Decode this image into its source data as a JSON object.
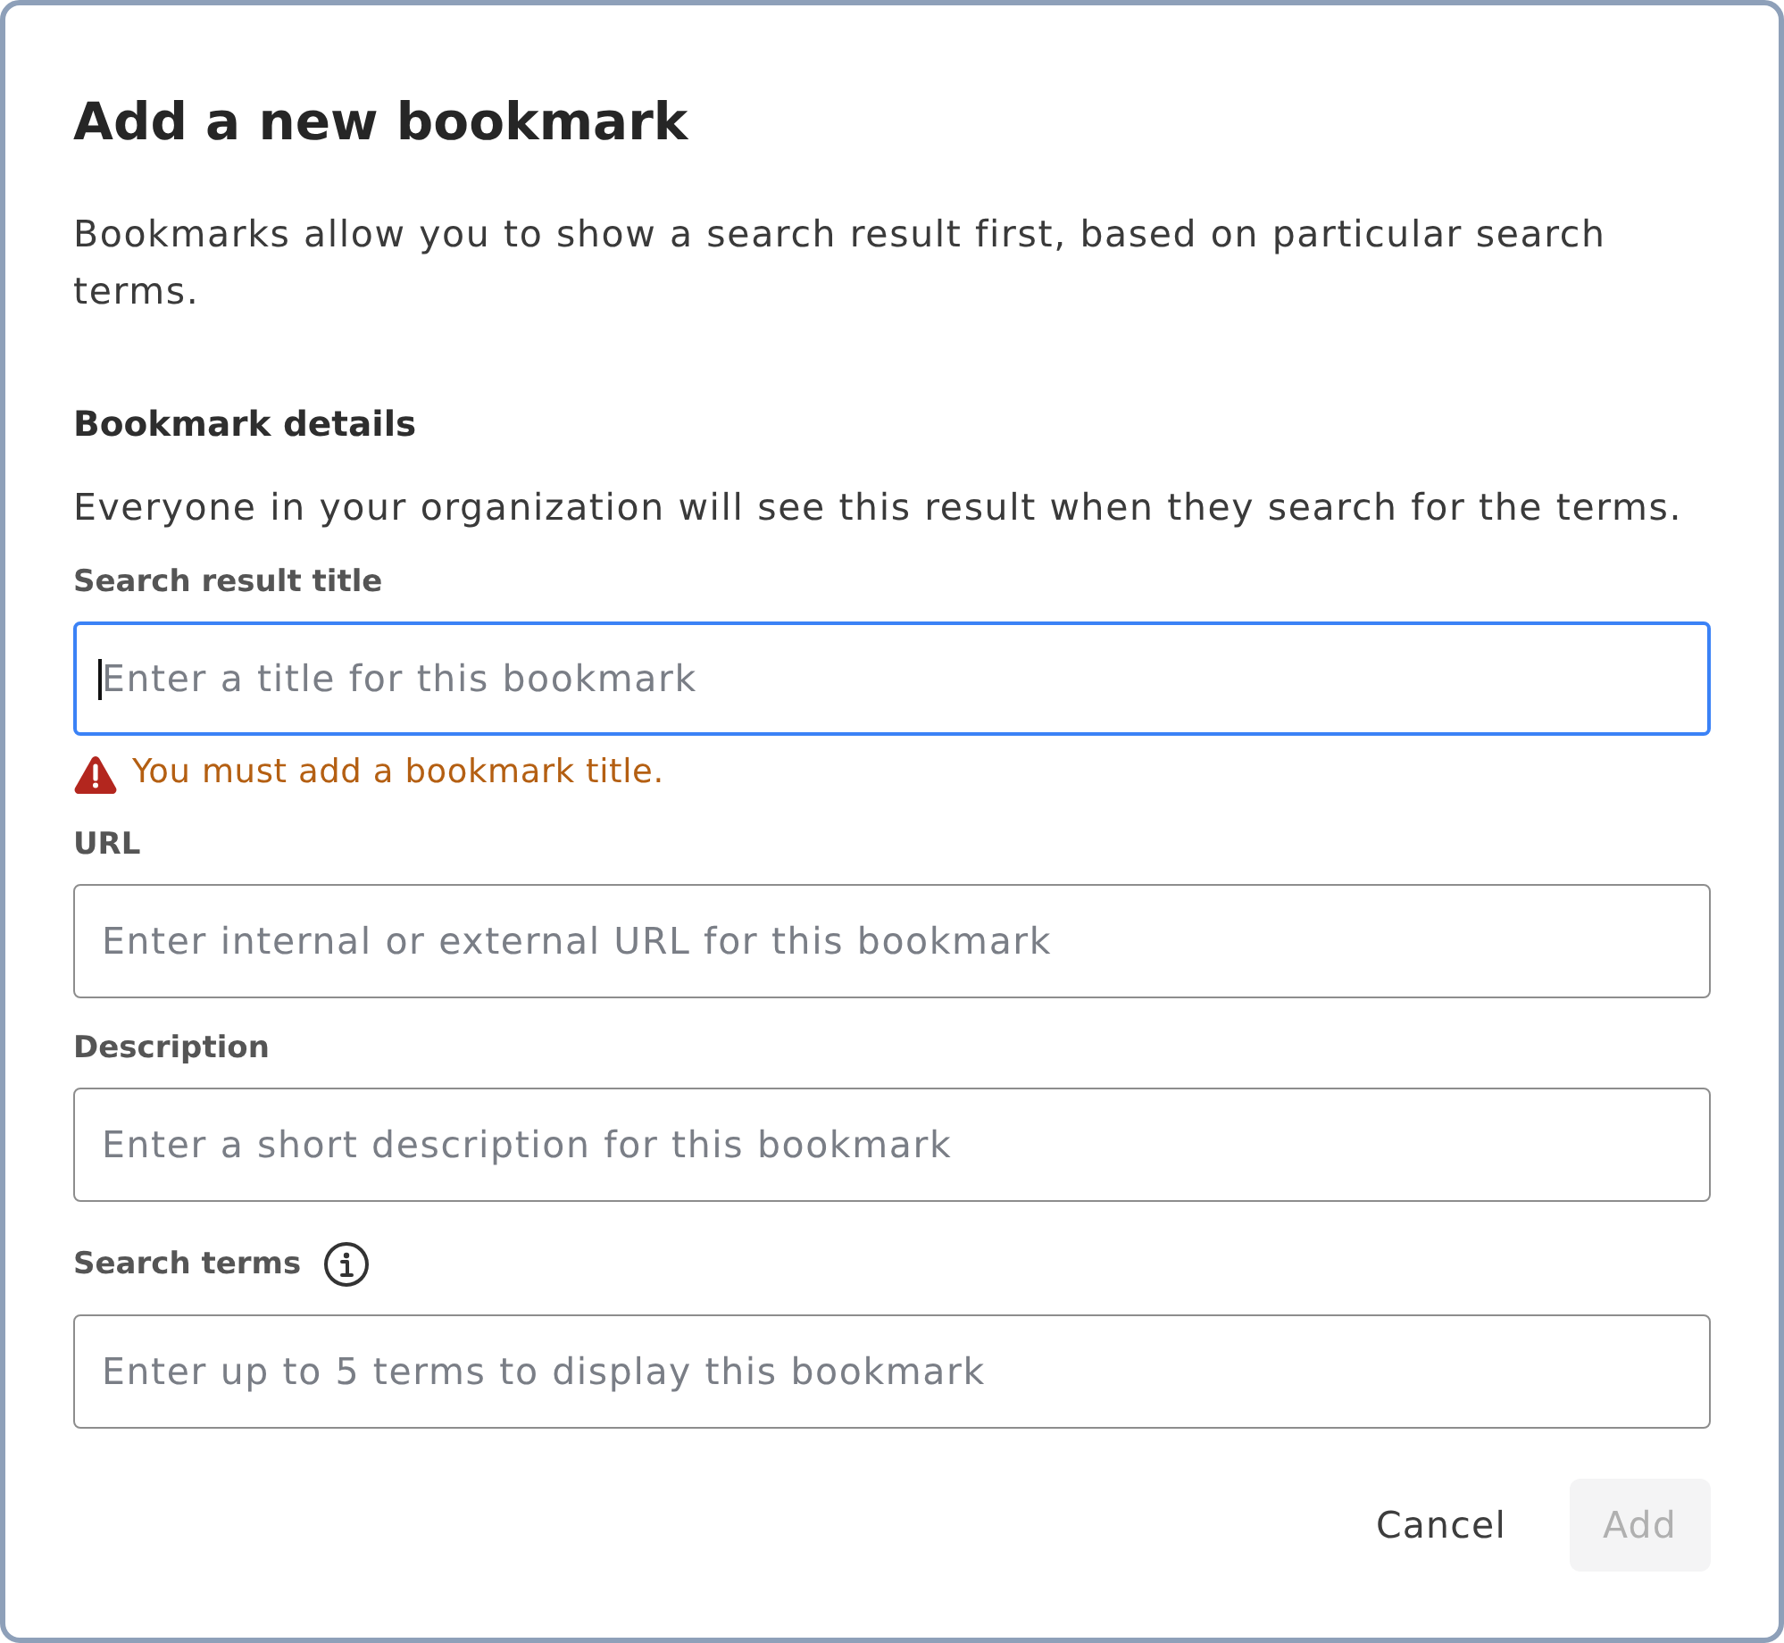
{
  "dialog": {
    "title": "Add a new bookmark",
    "description": "Bookmarks allow you to show a search result first, based on particular search terms.",
    "section": {
      "heading": "Bookmark details",
      "description": "Everyone in your organization will see this result when they search for the terms."
    },
    "fields": [
      {
        "label": "Search result title",
        "placeholder": "Enter a title for this bookmark",
        "focused": true,
        "info": false,
        "error": "You must add a bookmark title."
      },
      {
        "label": "URL",
        "placeholder": "Enter internal or external URL for this bookmark",
        "focused": false,
        "info": false
      },
      {
        "label": "Description",
        "placeholder": "Enter a short description for this bookmark",
        "focused": false,
        "info": false
      },
      {
        "label": "Search terms",
        "placeholder": "Enter up to 5 terms to display this bookmark",
        "focused": false,
        "info": true
      }
    ],
    "buttons": [
      {
        "label": "Cancel",
        "kind": "text",
        "disabled": false
      },
      {
        "label": "Add",
        "kind": "filled",
        "disabled": true
      }
    ]
  }
}
